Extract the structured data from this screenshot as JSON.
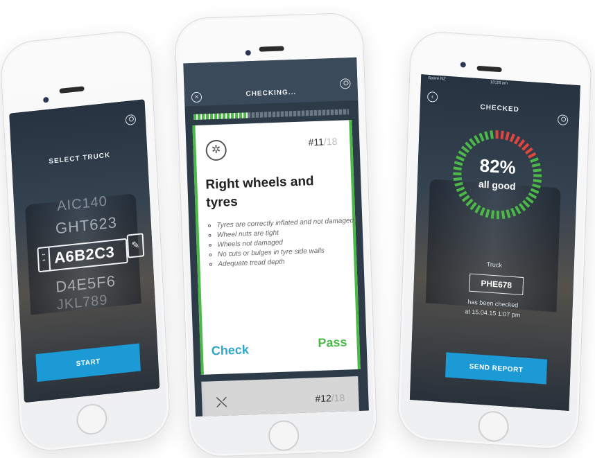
{
  "phone1": {
    "header_title": "SELECT TRUCK",
    "plates": [
      "AIC140",
      "GHT623",
      "A6B2C3",
      "D4E5F6",
      "JKL789"
    ],
    "selected_plate": "A6B2C3",
    "start_label": "START"
  },
  "phone2": {
    "header_title": "CHECKING...",
    "progress_fraction": 0.35,
    "card": {
      "counter_current": "#11",
      "counter_total": "/18",
      "title": "Right wheels and tyres",
      "bullets": [
        "Tyres are correctly inflated and not damaged",
        "Wheel nuts are tight",
        "Wheels not damaged",
        "No cuts or bulges in tyre side walls",
        "Adequate tread depth"
      ],
      "check_label": "Check",
      "pass_label": "Pass"
    },
    "next_card": {
      "counter_current": "#12",
      "counter_total": "/18"
    }
  },
  "phone3": {
    "status_bar": {
      "carrier": "Spare NZ",
      "time": "10:28 am"
    },
    "header_title": "CHECKED",
    "score_percent": "82%",
    "score_caption": "all good",
    "score_fraction": 0.82,
    "truck_label": "Truck",
    "truck_plate": "PHE678",
    "checked_line1": "has been checked",
    "checked_line2": "at 15.04.15 1:07 pm",
    "send_label": "SEND REPORT"
  },
  "colors": {
    "accent_blue": "#1b9ad6",
    "pass_green": "#4cb848",
    "fail_red": "#e0453e",
    "check_teal": "#2ea7c9"
  }
}
